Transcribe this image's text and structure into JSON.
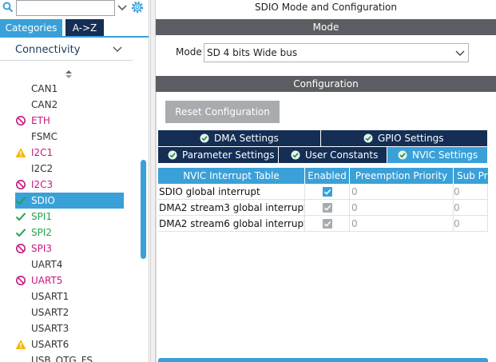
{
  "left_panel": {
    "tabs": {
      "categories": "Categories",
      "az": "A->Z"
    },
    "category": "Connectivity",
    "peripherals": [
      {
        "label": "CAN1",
        "status": "none",
        "color": "#333333"
      },
      {
        "label": "CAN2",
        "status": "none",
        "color": "#333333"
      },
      {
        "label": "ETH",
        "status": "blocked",
        "color": "#c8197f"
      },
      {
        "label": "FSMC",
        "status": "none",
        "color": "#333333"
      },
      {
        "label": "I2C1",
        "status": "warning",
        "color": "#c8197f"
      },
      {
        "label": "I2C2",
        "status": "none",
        "color": "#333333"
      },
      {
        "label": "I2C3",
        "status": "blocked",
        "color": "#c8197f"
      },
      {
        "label": "SDIO",
        "status": "ok",
        "color": "#ffffff",
        "selected": true
      },
      {
        "label": "SPI1",
        "status": "ok",
        "color": "#26a14a"
      },
      {
        "label": "SPI2",
        "status": "ok",
        "color": "#26a14a"
      },
      {
        "label": "SPI3",
        "status": "blocked",
        "color": "#c8197f"
      },
      {
        "label": "UART4",
        "status": "none",
        "color": "#333333"
      },
      {
        "label": "UART5",
        "status": "blocked",
        "color": "#c8197f"
      },
      {
        "label": "USART1",
        "status": "none",
        "color": "#333333"
      },
      {
        "label": "USART2",
        "status": "none",
        "color": "#333333"
      },
      {
        "label": "USART3",
        "status": "none",
        "color": "#333333"
      },
      {
        "label": "USART6",
        "status": "warning",
        "color": "#333333"
      },
      {
        "label": "USB_OTG_FS",
        "status": "none",
        "color": "#333333"
      }
    ]
  },
  "right_panel": {
    "title": "SDIO Mode and Configuration",
    "mode_section": "Mode",
    "mode_label": "Mode",
    "mode_value": "SD 4 bits Wide bus",
    "config_section": "Configuration",
    "reset_button": "Reset Configuration",
    "tabs_row1": [
      {
        "label": "DMA Settings"
      },
      {
        "label": "GPIO Settings"
      }
    ],
    "tabs_row2": [
      {
        "label": "Parameter Settings"
      },
      {
        "label": "User Constants"
      },
      {
        "label": "NVIC Settings",
        "active": true
      }
    ],
    "table": {
      "headers": [
        "NVIC Interrupt Table",
        "Enabled",
        "Preemption Priority",
        "Sub Pr"
      ],
      "rows": [
        {
          "name": "SDIO global interrupt",
          "enabled": true,
          "enabled_editable": true,
          "preemption": "0",
          "sub": "0"
        },
        {
          "name": "DMA2 stream3 global interrupt",
          "enabled": true,
          "enabled_editable": false,
          "preemption": "0",
          "sub": "0"
        },
        {
          "name": "DMA2 stream6 global interrupt",
          "enabled": true,
          "enabled_editable": false,
          "preemption": "0",
          "sub": "0"
        }
      ]
    }
  },
  "colors": {
    "accent": "#3aa0d8",
    "navy": "#142e55",
    "section_bar": "#5a5e63",
    "blocked": "#c8197f",
    "ok": "#26a14a",
    "warning": "#f5b800"
  },
  "icons": {
    "search": "search-icon",
    "settings": "gear-icon",
    "dropdown": "chevron-down-icon",
    "sort": "sort-icon",
    "tab_ok": "check-circle-icon",
    "checkbox": "checkbox-icon"
  }
}
